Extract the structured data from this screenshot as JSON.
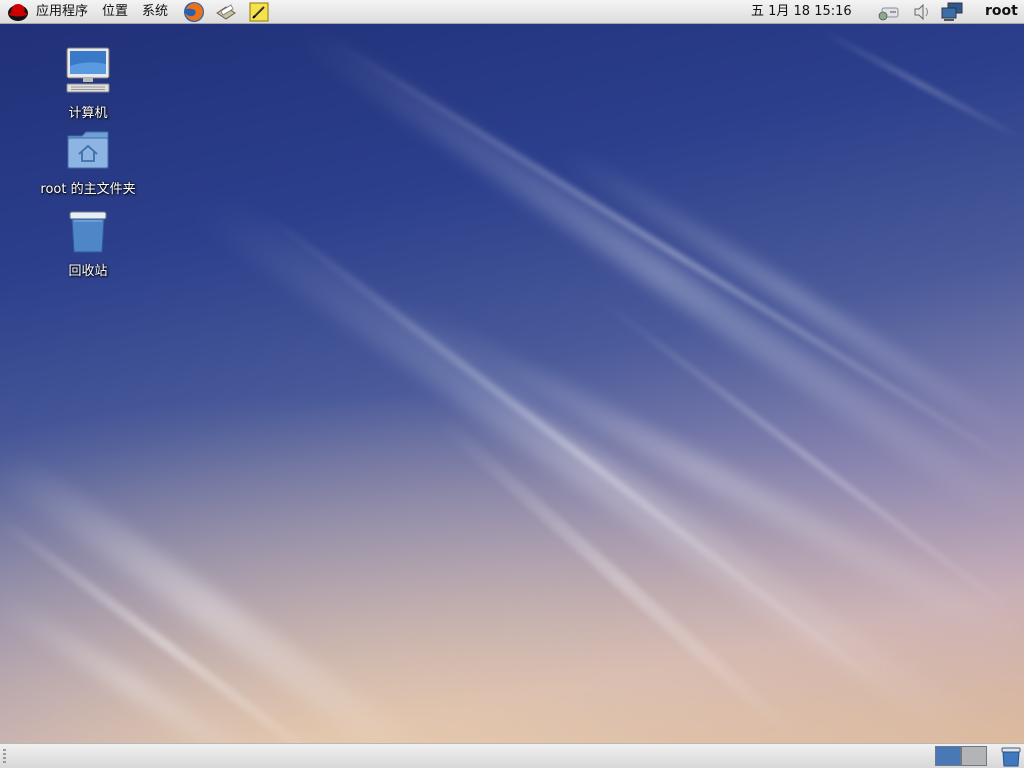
{
  "top_panel": {
    "menus": [
      {
        "label": "应用程序"
      },
      {
        "label": "位置"
      },
      {
        "label": "系统"
      }
    ],
    "launchers": [
      {
        "icon": "firefox-icon"
      },
      {
        "icon": "mail-client-icon"
      },
      {
        "icon": "text-editor-icon"
      }
    ],
    "clock": "五  1月 18 15:16",
    "tray": [
      {
        "icon": "network-printer-icon"
      },
      {
        "icon": "volume-icon"
      },
      {
        "icon": "network-status-icon"
      }
    ],
    "user": "root"
  },
  "desktop": {
    "icons": [
      {
        "label": "计算机",
        "icon": "computer-icon"
      },
      {
        "label": "root 的主文件夹",
        "icon": "home-folder-icon"
      },
      {
        "label": "回收站",
        "icon": "trash-icon"
      }
    ]
  },
  "bottom_panel": {
    "workspaces": [
      {
        "active": true,
        "color": "#4a78b4"
      },
      {
        "active": false,
        "color": "#b4b4b4"
      }
    ],
    "trash_applet": {
      "icon": "trash-applet-icon"
    }
  }
}
